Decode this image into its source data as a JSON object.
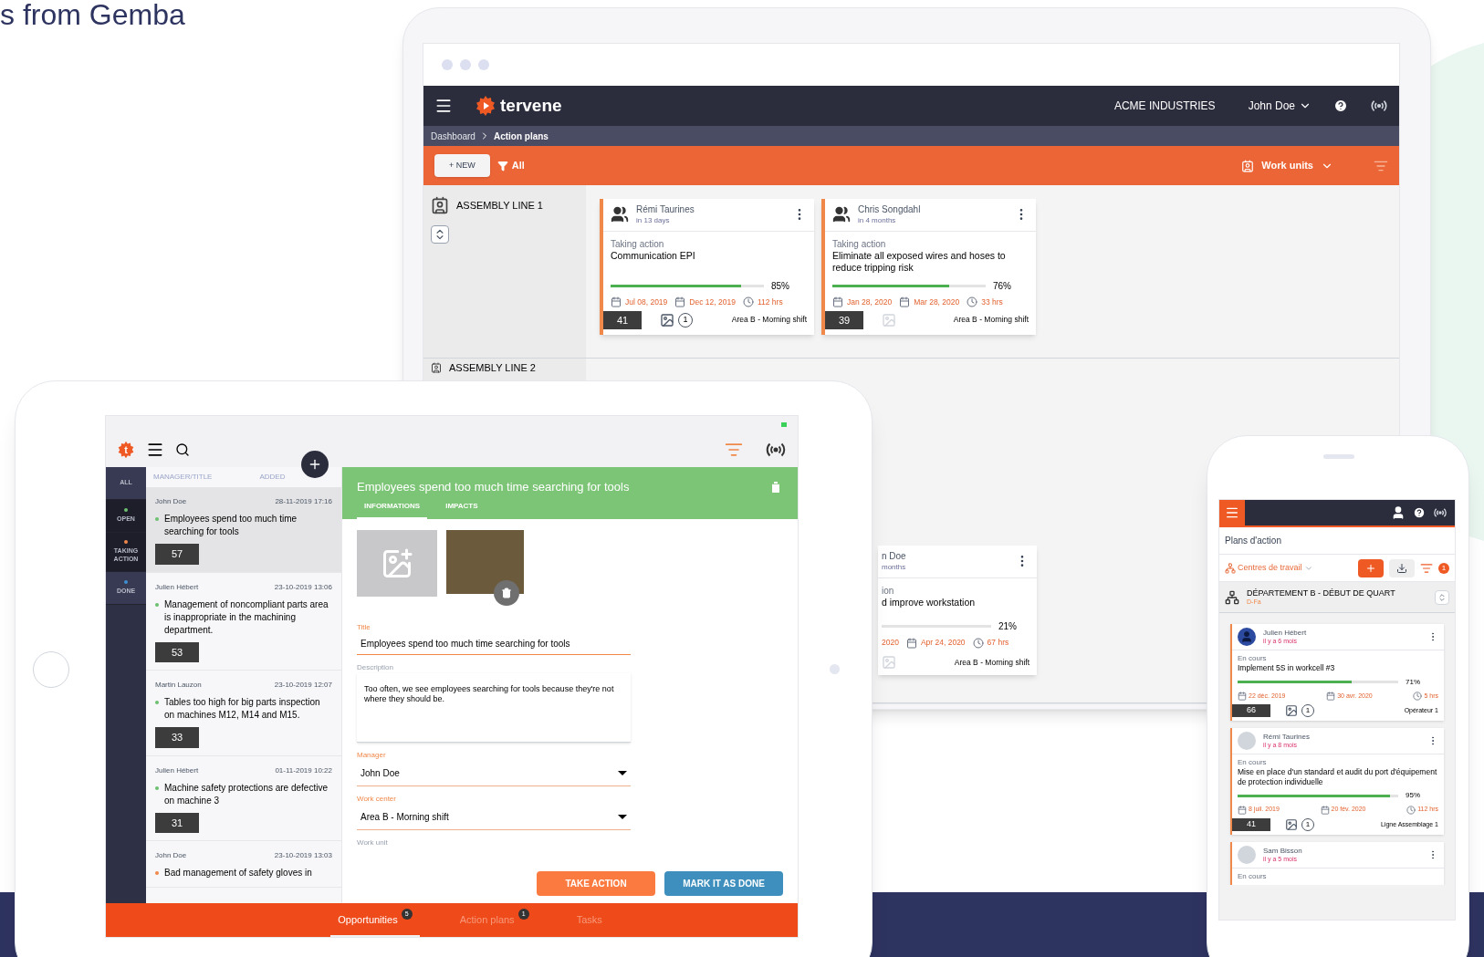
{
  "heading": "s from Gemba",
  "desktop": {
    "header": {
      "logo": "tervene",
      "company": "ACME INDUSTRIES",
      "user": "John Doe"
    },
    "breadcrumb": [
      {
        "label": "Dashboard",
        "selected": false
      },
      {
        "label": "Action plans",
        "selected": true
      }
    ],
    "toolbar": {
      "new_button": "+ NEW",
      "filter": "All",
      "work_units": "Work units"
    },
    "sections": [
      {
        "title": "ASSEMBLY LINE 1",
        "cards": [
          {
            "manager": "Rémi Taurines",
            "due": "in 13 days",
            "status": "Taking action",
            "title": "Communication EPI",
            "level": 0.85,
            "percent": "85%",
            "start": "Jul 08, 2019",
            "end": "Dec 12, 2019",
            "hours": "112 hrs",
            "number": "41",
            "attachments": "1",
            "work_center": "Area B - Morning shift"
          },
          {
            "manager": "Chris Songdahl",
            "due": "in 4 months",
            "status": "Taking action",
            "title": "Eliminate all exposed wires and hoses to reduce tripping risk",
            "level": 0.76,
            "percent": "76%",
            "start": "Jan 28, 2020",
            "end": "Mar 28, 2020",
            "hours": "33 hrs",
            "number": "39",
            "work_center": "Area B - Morning shift"
          }
        ]
      },
      {
        "title": "ASSEMBLY LINE 2"
      }
    ],
    "partial_card": {
      "manager": "n Doe",
      "due": "months",
      "status": "ion",
      "title": "d improve workstation",
      "percent": "21%",
      "start": "2020",
      "end": "Apr 24, 2020",
      "hours": "67 hrs",
      "work_center": "Area B - Morning shift"
    }
  },
  "tablet": {
    "logo_letter": "t",
    "filters": [
      {
        "label": "ALL",
        "selected": false
      },
      {
        "label": "OPEN",
        "selected": true,
        "color": "#6cc070"
      },
      {
        "label": "TAKING ACTION",
        "selected": true,
        "color": "#f0884a"
      },
      {
        "label": "DONE",
        "selected": false,
        "color": "#3f8fd0"
      }
    ],
    "list_headers": [
      "MANAGER/TITLE",
      "ADDED"
    ],
    "items": [
      {
        "manager": "John Doe",
        "added": "28-11-2019 17:16",
        "title": "Employees spend too much time searching for tools",
        "number": "57",
        "color": "#6cc070",
        "selected": true
      },
      {
        "manager": "Julien Hébert",
        "added": "23-10-2019 13:06",
        "title": "Management of noncompliant parts area is inappropriate in the machining department.",
        "number": "53",
        "color": "#6cc070",
        "selected": false
      },
      {
        "manager": "Martin Lauzon",
        "added": "23-10-2019 12:07",
        "title": "Tables too high for big parts inspection on machines M12, M14 and M15.",
        "number": "33",
        "color": "#6cc070",
        "selected": false
      },
      {
        "manager": "Julien Hébert",
        "added": "01-11-2019 10:22",
        "title": "Machine safety protections are defective on machine 3",
        "number": "31",
        "color": "#6cc070",
        "selected": false
      },
      {
        "manager": "John Doe",
        "added": "23-10-2019 13:03",
        "title": "Bad management of safety gloves in",
        "color": "#f0884a",
        "selected": false
      }
    ],
    "detail": {
      "title": "Employees spend too much time searching for tools",
      "tabs": [
        {
          "label": "INFORMATIONS",
          "selected": true
        },
        {
          "label": "IMPACTS",
          "selected": false
        }
      ],
      "fields": [
        {
          "label": "Title",
          "value": "Employees spend too much time searching for tools",
          "kind": "text"
        },
        {
          "label": "Description",
          "value": "Too often, we see employees searching for tools because they're not where they should be.",
          "kind": "textarea"
        },
        {
          "label": "Manager",
          "value": "John Doe",
          "kind": "select"
        },
        {
          "label": "Work center",
          "value": "Area B - Morning shift",
          "kind": "select"
        },
        {
          "label": "Work unit",
          "kind": "empty"
        }
      ],
      "buttons": [
        {
          "label": "TAKE ACTION",
          "kind": "primary"
        },
        {
          "label": "MARK IT AS DONE",
          "kind": "secondary"
        }
      ]
    },
    "nav": [
      {
        "label": "Opportunities",
        "badge": "5",
        "selected": true
      },
      {
        "label": "Action plans",
        "badge": "1",
        "selected": false
      },
      {
        "label": "Tasks",
        "selected": false
      }
    ]
  },
  "phone": {
    "title": "Plans d'action",
    "filter": "Centres de travail",
    "filter_count": "1",
    "department": "DÉPARTEMENT B - DÉBUT DE QUART",
    "department_code": "D-Fa",
    "cards": [
      {
        "manager": "Julien Hébert",
        "ago": "il y a 6 mois",
        "has_photo": false,
        "status": "En cours",
        "title": "Implement 5S in workcell #3",
        "level": 0.71,
        "percent": "71%",
        "start": "22 déc. 2019",
        "end": "30 avr. 2020",
        "hours": "5 hrs",
        "number": "66",
        "attachments": "1",
        "work_center": "Opérateur 1"
      },
      {
        "manager": "Rémi Taurines",
        "ago": "il y a 8 mois",
        "has_photo": true,
        "status": "En cours",
        "title": "Mise en place d'un standard et audit du port d'équipement de protection individuelle",
        "level": 0.95,
        "percent": "95%",
        "start": "8 juil. 2019",
        "end": "20 fév. 2020",
        "hours": "112 hrs",
        "number": "41",
        "attachments": "1",
        "work_center": "Ligne Assemblage 1"
      },
      {
        "manager": "Sam Bisson",
        "ago": "il y a 5 mois",
        "has_photo": true,
        "status": "En cours"
      }
    ]
  }
}
